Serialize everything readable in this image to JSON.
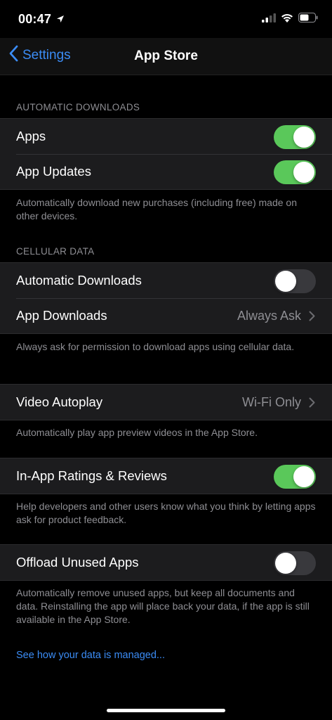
{
  "status": {
    "time": "00:47"
  },
  "nav": {
    "back_label": "Settings",
    "title": "App Store"
  },
  "sections": {
    "auto_downloads": {
      "header": "AUTOMATIC DOWNLOADS",
      "rows": [
        {
          "label": "Apps",
          "toggle": true
        },
        {
          "label": "App Updates",
          "toggle": true
        }
      ],
      "footer": "Automatically download new purchases (including free) made on other devices."
    },
    "cellular": {
      "header": "CELLULAR DATA",
      "rows": [
        {
          "label": "Automatic Downloads",
          "toggle": false
        },
        {
          "label": "App Downloads",
          "value": "Always Ask"
        }
      ],
      "footer": "Always ask for permission to download apps using cellular data."
    },
    "video": {
      "rows": [
        {
          "label": "Video Autoplay",
          "value": "Wi-Fi Only"
        }
      ],
      "footer": "Automatically play app preview videos in the App Store."
    },
    "ratings": {
      "rows": [
        {
          "label": "In-App Ratings & Reviews",
          "toggle": true
        }
      ],
      "footer": "Help developers and other users know what you think by letting apps ask for product feedback."
    },
    "offload": {
      "rows": [
        {
          "label": "Offload Unused Apps",
          "toggle": false
        }
      ],
      "footer": "Automatically remove unused apps, but keep all documents and data. Reinstalling the app will place back your data, if the app is still available in the App Store."
    }
  },
  "link": "See how your data is managed...",
  "colors": {
    "accent": "#3b8cf5",
    "switch_on": "#5ac85a",
    "switch_off": "#39393d"
  }
}
